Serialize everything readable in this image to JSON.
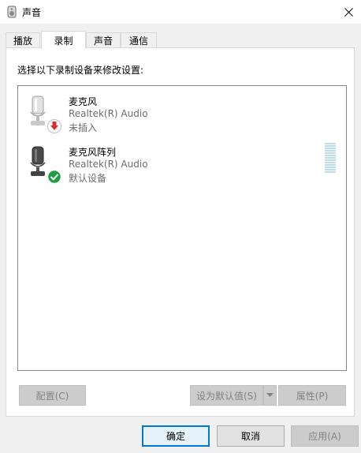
{
  "window": {
    "title": "声音",
    "icon": "speaker-icon",
    "close_icon": "close-icon"
  },
  "tabs": [
    {
      "label": "播放",
      "active": false
    },
    {
      "label": "录制",
      "active": true
    },
    {
      "label": "声音",
      "active": false
    },
    {
      "label": "通信",
      "active": false
    }
  ],
  "panel": {
    "instruction": "选择以下录制设备来修改设置:",
    "devices": [
      {
        "name": "麦克风",
        "driver": "Realtek(R) Audio",
        "status": "未插入",
        "icon": "microphone-icon",
        "badge": "unplugged-badge-icon"
      },
      {
        "name": "麦克风阵列",
        "driver": "Realtek(R) Audio",
        "status": "默认设备",
        "icon": "microphone-icon",
        "badge": "default-check-badge-icon"
      }
    ],
    "buttons": {
      "configure": "配置(C)",
      "set_default": "设为默认值(S)",
      "properties": "属性(P)"
    }
  },
  "dialog_buttons": {
    "ok": "确定",
    "cancel": "取消",
    "apply": "应用(A)"
  },
  "colors": {
    "accent": "#0078d7",
    "unplugged_red": "#d32f2f",
    "default_green": "#1f9d40",
    "level_meter": "#bcdcea"
  }
}
